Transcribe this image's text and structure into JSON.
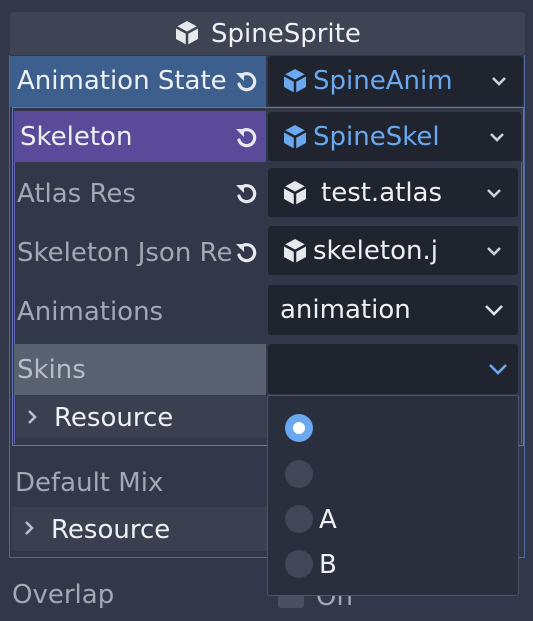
{
  "inspector": {
    "title": "SpineSprite",
    "rows": {
      "animation_state": {
        "label": "Animation State",
        "value": "SpineAnim"
      },
      "skeleton": {
        "label": "Skeleton",
        "value": "SpineSkel"
      },
      "atlas_res": {
        "label": "Atlas Res",
        "value": "test.atlas"
      },
      "skeleton_json_res": {
        "label": "Skeleton Json Re",
        "value": "skeleton.j"
      },
      "animations": {
        "label": "Animations",
        "value": "animation"
      },
      "skins": {
        "label": "Skins",
        "value": ""
      },
      "resource_1": {
        "label": "Resource"
      },
      "default_mix": {
        "label": "Default Mix"
      },
      "resource_2": {
        "label": "Resource"
      },
      "overlap": {
        "label": "Overlap",
        "value": "On"
      }
    }
  },
  "skins_dropdown": {
    "options": [
      {
        "label": "",
        "selected": true
      },
      {
        "label": "",
        "selected": false
      },
      {
        "label": "A",
        "selected": false
      },
      {
        "label": "B",
        "selected": false
      }
    ]
  },
  "colors": {
    "background": "#323849",
    "animation_state_row": "#3d5f8e",
    "skeleton_row": "#5a4a9a",
    "accent": "#6aa8f0",
    "dropdown_bg": "#2a2f3d"
  }
}
